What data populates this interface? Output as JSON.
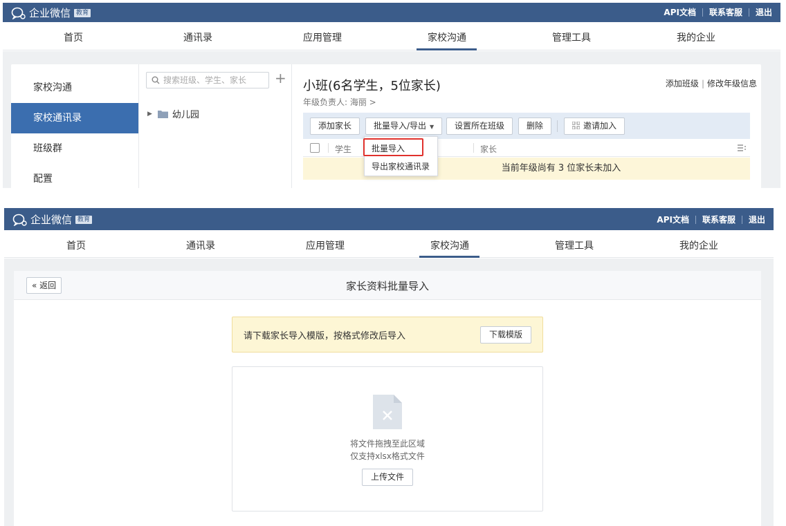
{
  "app": {
    "logo_text": "企业微信",
    "edu_badge": "教育"
  },
  "top_links": {
    "api_docs": "API文档",
    "support": "联系客服",
    "logout": "退出"
  },
  "nav": {
    "items": [
      "首页",
      "通讯录",
      "应用管理",
      "家校沟通",
      "管理工具",
      "我的企业"
    ],
    "active": "家校沟通"
  },
  "screen1": {
    "sidebar": [
      "家校沟通",
      "家校通讯录",
      "班级群",
      "配置"
    ],
    "sidebar_active": "家校通讯录",
    "search_placeholder": "搜索班级、学生、家长",
    "plus": "+",
    "tree_root": "幼儿园",
    "class_title": "小班(6名学生，5位家长)",
    "grade_owner": "年级负责人: 海丽 >",
    "right_links": {
      "add_class": "添加班级",
      "edit_grade": "修改年级信息"
    },
    "toolbar": {
      "add_parent": "添加家长",
      "bulk_import_export": "批量导入/导出",
      "set_class": "设置所在班级",
      "delete": "删除",
      "invite": "邀请加入"
    },
    "table_headers": {
      "student": "学生",
      "parent": "家长"
    },
    "warning": "当前年级尚有 3 位家长未加入",
    "dropdown": {
      "bulk_import": "批量导入",
      "export": "导出家校通讯录"
    }
  },
  "screen2": {
    "back": "« 返回",
    "title": "家长资料批量导入",
    "tip": "请下载家长导入模版，按格式修改后导入",
    "download_btn": "下载模版",
    "drop_line1": "将文件拖拽至此区域",
    "drop_line2": "仅支持xlsx格式文件",
    "upload_btn": "上传文件"
  },
  "colors": {
    "brand": "#3b5c8a",
    "active_side": "#3b6eaf",
    "highlight": "#e0312c"
  }
}
